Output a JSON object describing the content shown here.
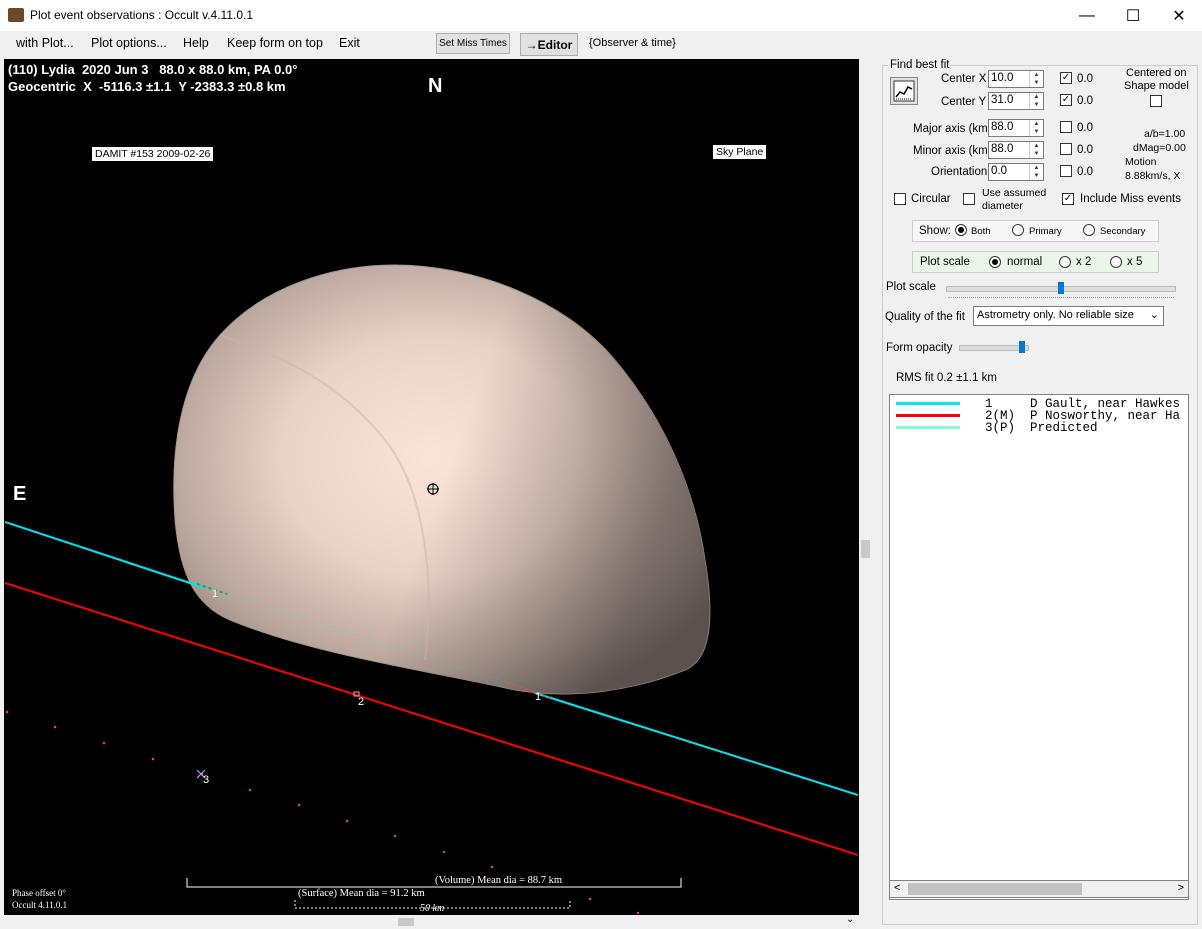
{
  "window": {
    "title": "Plot event observations : Occult v.4.11.0.1",
    "minimize": "—",
    "maximize": "☐",
    "close": "✕"
  },
  "menu": {
    "with_plot": "with Plot...",
    "plot_options": "Plot options...",
    "help": "Help",
    "keep_on_top": "Keep form on top",
    "exit": "Exit",
    "set_miss_times": "Set Miss Times",
    "editor": "→Editor",
    "observer_time": "{Observer & time}"
  },
  "plot": {
    "header_line1": "(110) Lydia  2020 Jun 3   88.0 x 88.0 km, PA 0.0°",
    "header_line2": "Geocentric  X  -5116.3 ±1.1  Y -2383.3 ±0.8 km",
    "north": "N",
    "east": "E",
    "damit_label": "DAMIT #153 2009-02-26",
    "sky_plane": "Sky Plane",
    "chord_labels": [
      "1",
      "1",
      "2",
      "3"
    ],
    "volume_dia": "(Volume) Mean dia = 88.7 km",
    "surface_dia": "(Surface) Mean dia = 91.2 km",
    "scale_bar": "50 km",
    "phase_offset": "Phase offset 0°",
    "version": "Occult 4.11.0.1",
    "colors": {
      "chord1": "#00e5ee",
      "chord2": "#ff0000",
      "predicted": "#7fffd4",
      "asteroid": "#f5ddd2"
    }
  },
  "fit": {
    "group_title": "Find best fit",
    "center_x_label": "Center X",
    "center_x": "10.0",
    "center_x_check": "0.0",
    "center_y_label": "Center Y",
    "center_y": "31.0",
    "center_y_check": "0.0",
    "major_label": "Major axis (km)",
    "major": "88.0",
    "major_check": "0.0",
    "minor_label": "Minor axis (km)",
    "minor": "88.0",
    "minor_check": "0.0",
    "orient_label": "Orientation",
    "orient": "0.0",
    "orient_check": "0.0",
    "centered_on": "Centered on",
    "shape_model": "Shape model",
    "ab_ratio": "a/b=1.00",
    "dmag": "dMag=0.00",
    "motion": "Motion",
    "motion_val": "8.88km/s, X",
    "circular": "Circular",
    "use_assumed": "Use assumed",
    "diameter": "diameter",
    "include_miss": "Include Miss events"
  },
  "show": {
    "label": "Show:",
    "both": "Both",
    "primary": "Primary",
    "secondary": "Secondary"
  },
  "scale": {
    "label": "Plot scale",
    "normal": "normal",
    "x2": "x 2",
    "x5": "x 5",
    "slider_label": "Plot scale",
    "slider_level": 0.5
  },
  "quality": {
    "label": "Quality of the fit",
    "value": "Astrometry only. No reliable size"
  },
  "opacity": {
    "label": "Form opacity",
    "level": 0.95
  },
  "rms": "RMS fit 0.2 ±1.1 km",
  "legend": [
    {
      "num": "1",
      "text": "1     D Gault, near Hawkes",
      "color": "#00e5ee"
    },
    {
      "num": "2",
      "text": "2(M)  P Nosworthy, near Ha",
      "color": "#ff0000"
    },
    {
      "num": "3",
      "text": "3(P)  Predicted",
      "color": "#7fffd4"
    }
  ]
}
